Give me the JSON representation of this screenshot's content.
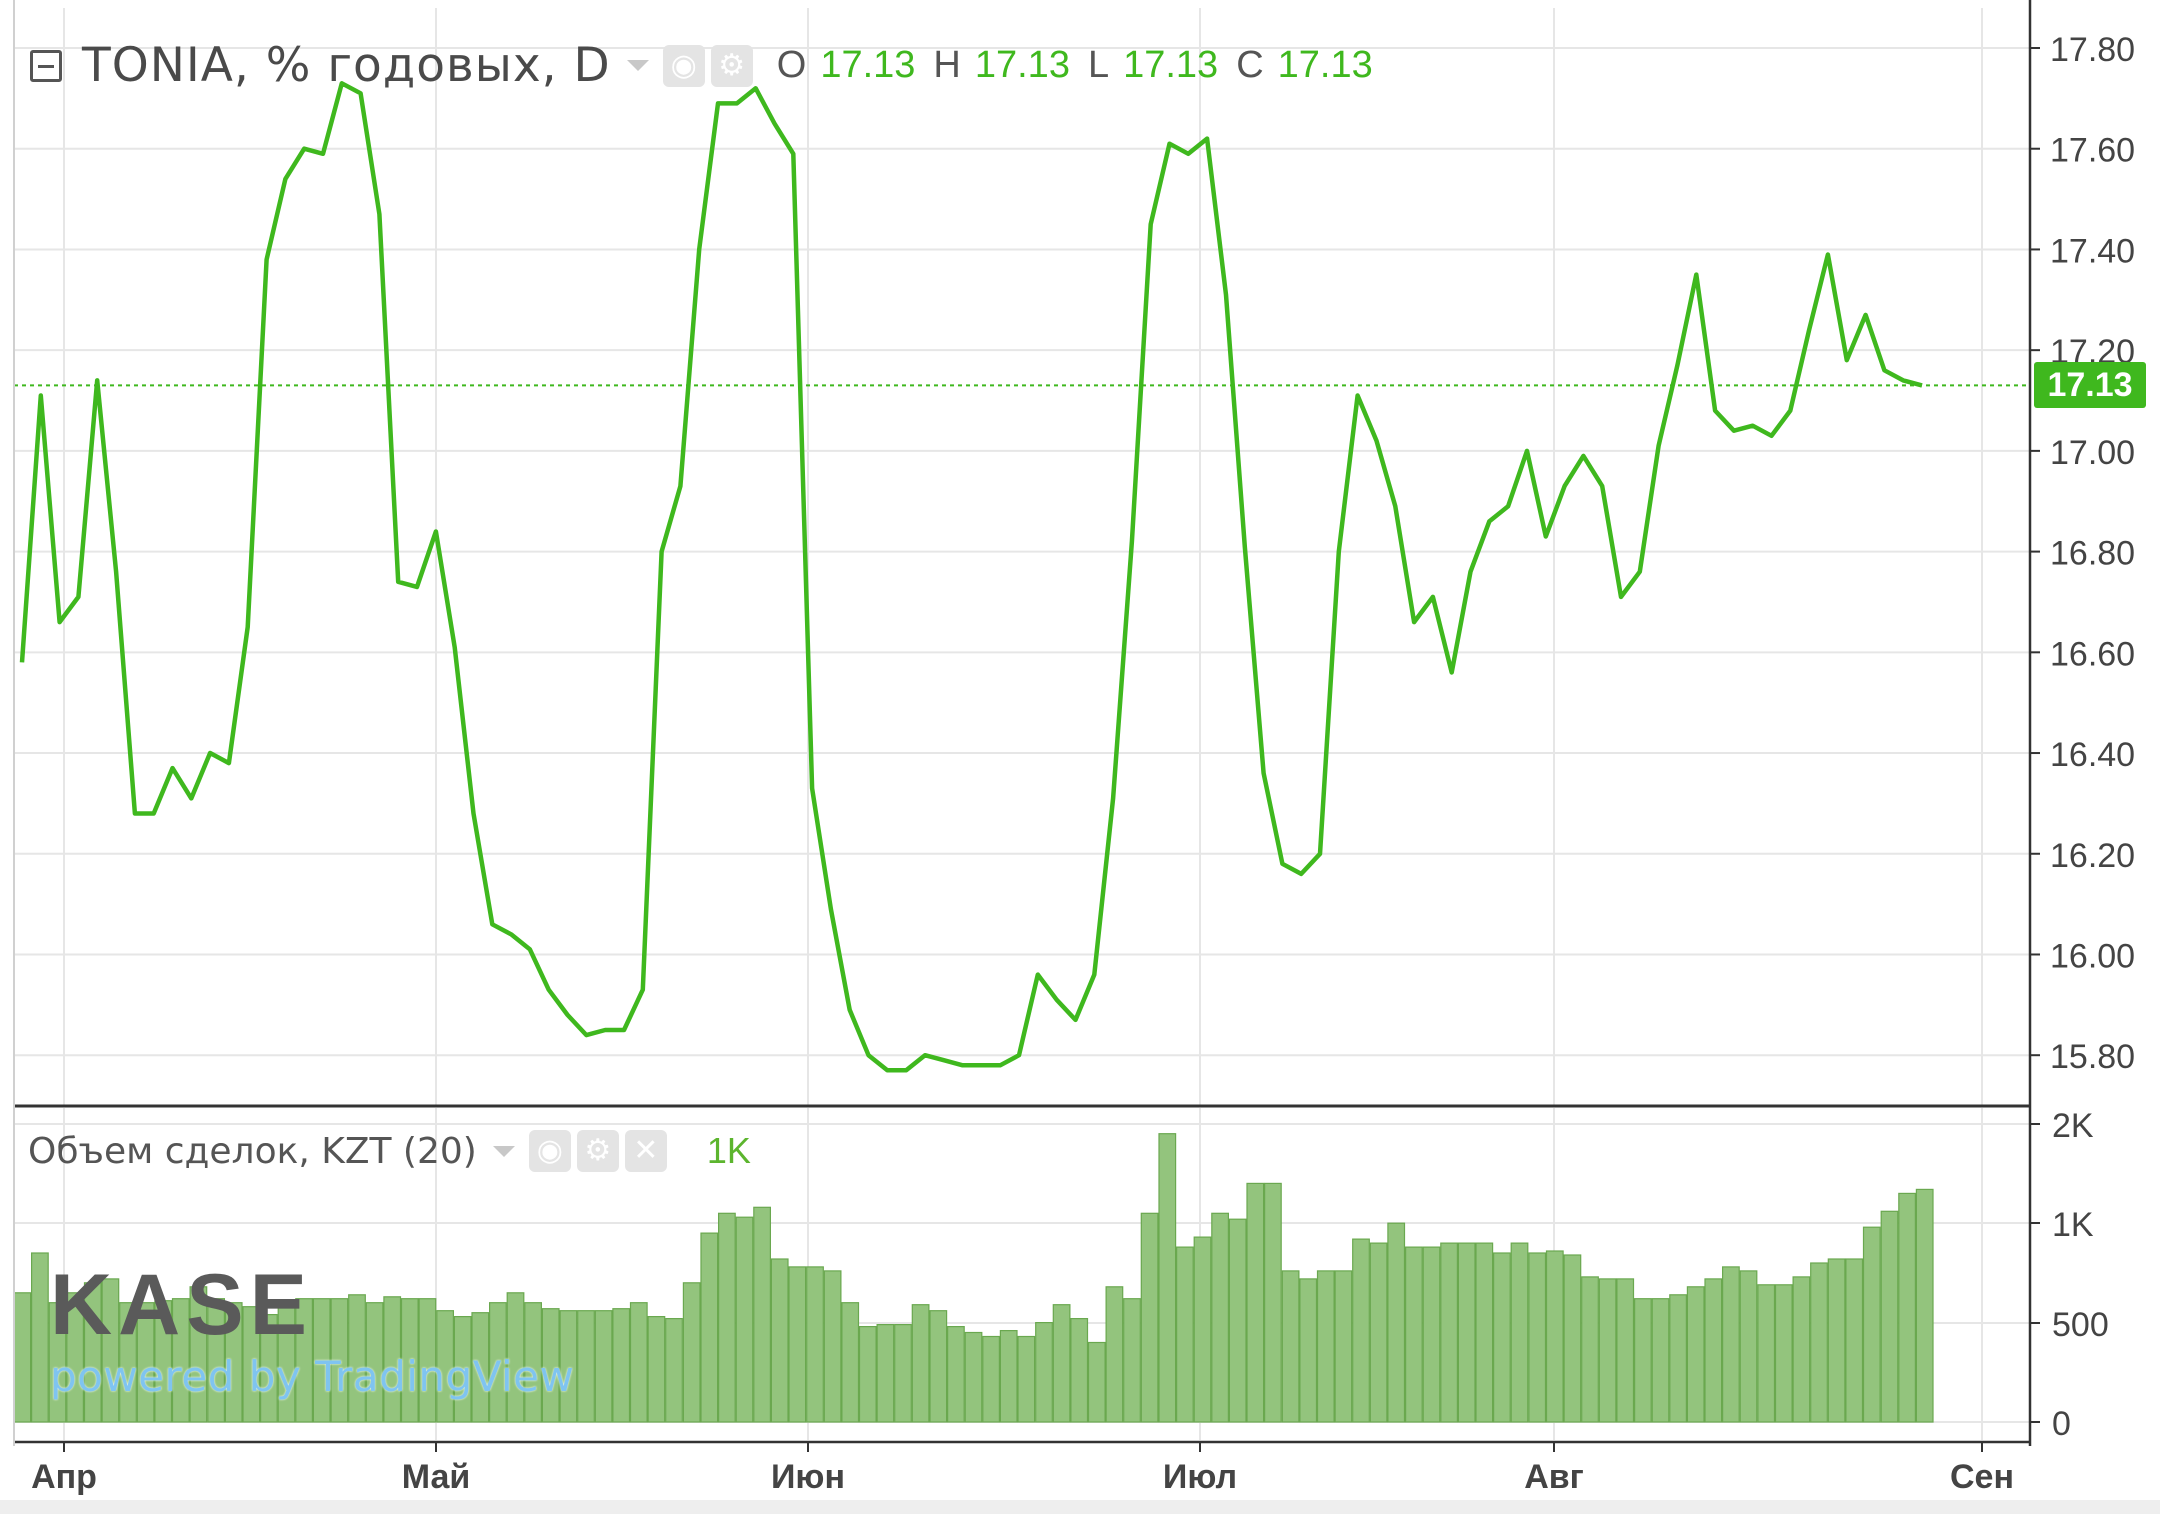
{
  "legend": {
    "title": "TONIA, % годовых, D",
    "ohlc": [
      {
        "key": "O",
        "value": "17.13"
      },
      {
        "key": "H",
        "value": "17.13"
      },
      {
        "key": "L",
        "value": "17.13"
      },
      {
        "key": "C",
        "value": "17.13"
      }
    ]
  },
  "volume_legend": {
    "title": "Объем сделок, KZT (20)",
    "value": "1K"
  },
  "last_price_label": "17.13",
  "watermark": {
    "logo": "KASE",
    "powered_by": "powered by TradingView"
  },
  "colors": {
    "line": "#3fb81e",
    "volume_bar": "#93c47d",
    "volume_bar_border": "#6aa84f",
    "grid": "#e6e6e6",
    "axis": "#333333"
  },
  "chart_data": [
    {
      "type": "line",
      "series": [
        {
          "name": "TONIA, % годовых",
          "values": [
            16.58,
            17.11,
            16.66,
            16.71,
            17.14,
            16.76,
            16.28,
            16.28,
            16.37,
            16.31,
            16.4,
            16.38,
            16.65,
            17.38,
            17.54,
            17.6,
            17.59,
            17.73,
            17.71,
            17.47,
            16.74,
            16.73,
            16.84,
            16.61,
            16.28,
            16.06,
            16.04,
            16.01,
            15.93,
            15.88,
            15.84,
            15.85,
            15.85,
            15.93,
            16.8,
            16.93,
            17.4,
            17.69,
            17.69,
            17.72,
            17.65,
            17.59,
            16.33,
            16.09,
            15.89,
            15.8,
            15.77,
            15.77,
            15.8,
            15.79,
            15.78,
            15.78,
            15.78,
            15.8,
            15.96,
            15.91,
            15.87,
            15.96,
            16.31,
            16.82,
            17.45,
            17.61,
            17.59,
            17.62,
            17.31,
            16.81,
            16.36,
            16.18,
            16.16,
            16.2,
            16.8,
            17.11,
            17.02,
            16.89,
            16.66,
            16.71,
            16.56,
            16.76,
            16.86,
            16.89,
            17.0,
            16.83,
            16.93,
            16.99,
            16.93,
            16.71,
            16.76,
            17.01,
            17.17,
            17.35,
            17.08,
            17.04,
            17.05,
            17.03,
            17.08,
            17.24,
            17.39,
            17.18,
            17.27,
            17.16,
            17.14,
            17.13
          ]
        }
      ],
      "last_value": 17.13,
      "ylim": [
        15.7,
        17.85
      ],
      "yticks": [
        "15.80",
        "16.00",
        "16.20",
        "16.40",
        "16.60",
        "16.80",
        "17.00",
        "17.20",
        "17.40",
        "17.60",
        "17.80"
      ],
      "xticks": [
        "Апр",
        "Май",
        "Июн",
        "Июл",
        "Авг",
        "Сен"
      ],
      "grid": true
    },
    {
      "type": "bar",
      "series": [
        {
          "name": "Объем сделок, KZT",
          "values": [
            650,
            850,
            600,
            650,
            700,
            720,
            600,
            600,
            610,
            620,
            680,
            620,
            600,
            580,
            540,
            600,
            620,
            620,
            620,
            640,
            600,
            630,
            620,
            620,
            560,
            530,
            550,
            600,
            650,
            600,
            570,
            560,
            560,
            560,
            570,
            600,
            530,
            520,
            700,
            950,
            1050,
            1030,
            1080,
            820,
            780,
            780,
            760,
            600,
            480,
            490,
            490,
            590,
            560,
            480,
            450,
            430,
            460,
            430,
            500,
            590,
            520,
            400,
            680,
            620,
            1050,
            1450,
            880,
            930,
            1050,
            1020,
            1200,
            1200,
            760,
            720,
            760,
            760,
            920,
            900,
            1000,
            880,
            880,
            900,
            900,
            900,
            850,
            900,
            850,
            860,
            840,
            730,
            720,
            720,
            620,
            620,
            640,
            680,
            720,
            780,
            760,
            690,
            690,
            730,
            800,
            820,
            820,
            980,
            1060,
            1150,
            1170
          ]
        }
      ],
      "ylim": [
        0,
        1500
      ],
      "yticks": [
        "0",
        "500",
        "1K",
        "2K"
      ],
      "xticks": [
        "Апр",
        "Май",
        "Июн",
        "Июл",
        "Авг",
        "Сен"
      ],
      "grid": true
    }
  ]
}
